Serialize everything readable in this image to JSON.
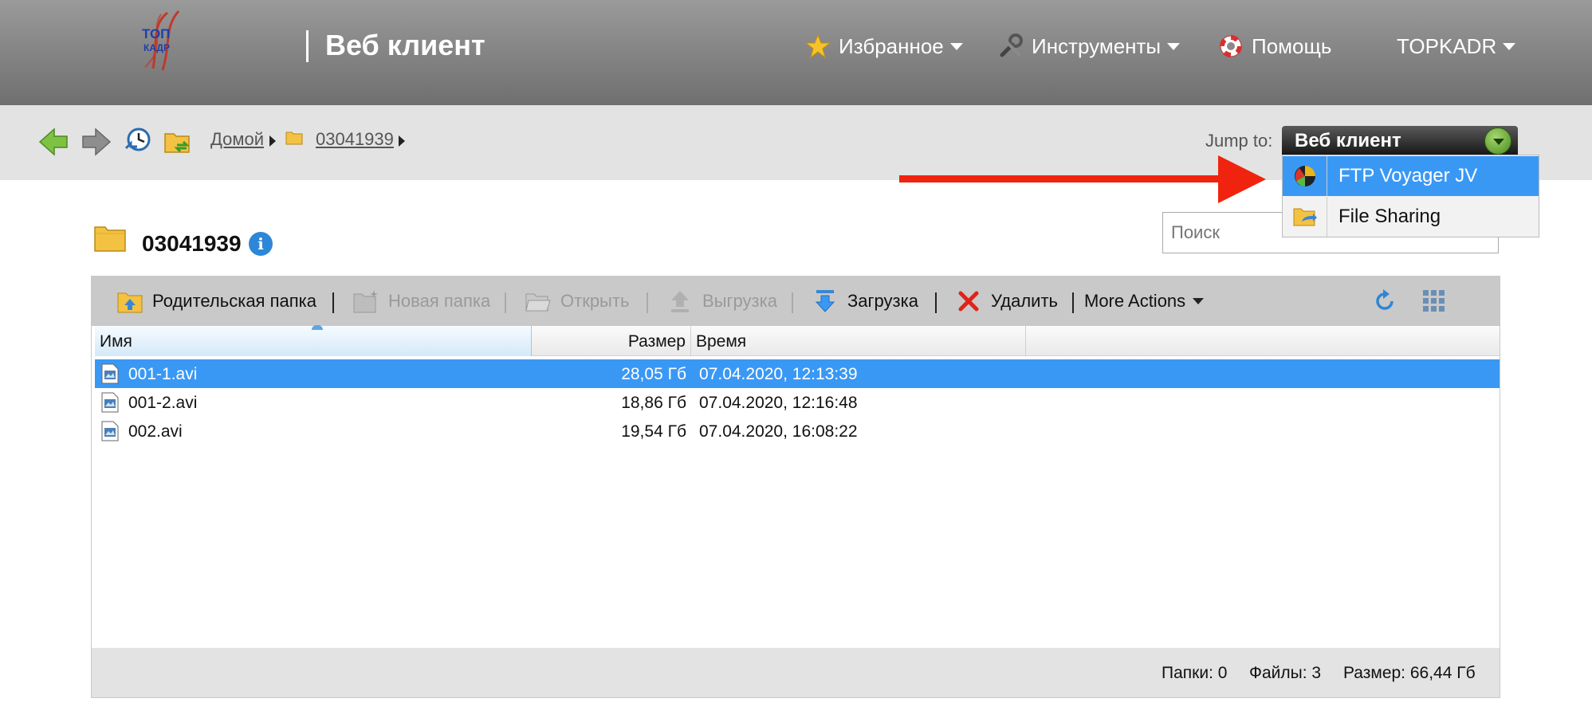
{
  "header": {
    "logo_text": [
      "ТОП",
      "КАДР"
    ],
    "brand": "Веб клиент",
    "nav": [
      {
        "label": "Избранное",
        "icon": "star-icon",
        "has_menu": true
      },
      {
        "label": "Инструменты",
        "icon": "tools-icon",
        "has_menu": true
      },
      {
        "label": "Помощь",
        "icon": "lifebuoy-icon",
        "has_menu": false
      },
      {
        "label": "TOPKADR",
        "icon": "",
        "has_menu": true
      }
    ]
  },
  "breadcrumb": {
    "home": "Домой",
    "folder": "03041939"
  },
  "jump": {
    "label": "Jump to:",
    "selected": "Веб клиент",
    "options": [
      {
        "label": "FTP Voyager JV",
        "icon": "voyager-icon",
        "selected": true
      },
      {
        "label": "File Sharing",
        "icon": "file-sharing-icon",
        "selected": false
      }
    ]
  },
  "folder": {
    "name": "03041939"
  },
  "search": {
    "placeholder": "Поиск"
  },
  "toolbar": {
    "parent_folder": "Родительская папка",
    "new_folder": "Новая папка",
    "open": "Открыть",
    "upload": "Выгрузка",
    "download": "Загрузка",
    "delete": "Удалить",
    "more_actions": "More Actions"
  },
  "table": {
    "columns": {
      "name": "Имя",
      "size": "Размер",
      "time": "Время"
    },
    "rows": [
      {
        "name": "001-1.avi",
        "size": "28,05 Гб",
        "time": "07.04.2020, 12:13:39",
        "selected": true
      },
      {
        "name": "001-2.avi",
        "size": "18,86 Гб",
        "time": "07.04.2020, 12:16:48",
        "selected": false
      },
      {
        "name": "002.avi",
        "size": "19,54 Гб",
        "time": "07.04.2020, 16:08:22",
        "selected": false
      }
    ]
  },
  "status": {
    "folders": "Папки: 0",
    "files": "Файлы: 3",
    "size": "Размер: 66,44 Гб"
  },
  "colors": {
    "header_bg": "#7f7f7f",
    "selection": "#3a98f5",
    "annotation_arrow": "#f0230e"
  }
}
